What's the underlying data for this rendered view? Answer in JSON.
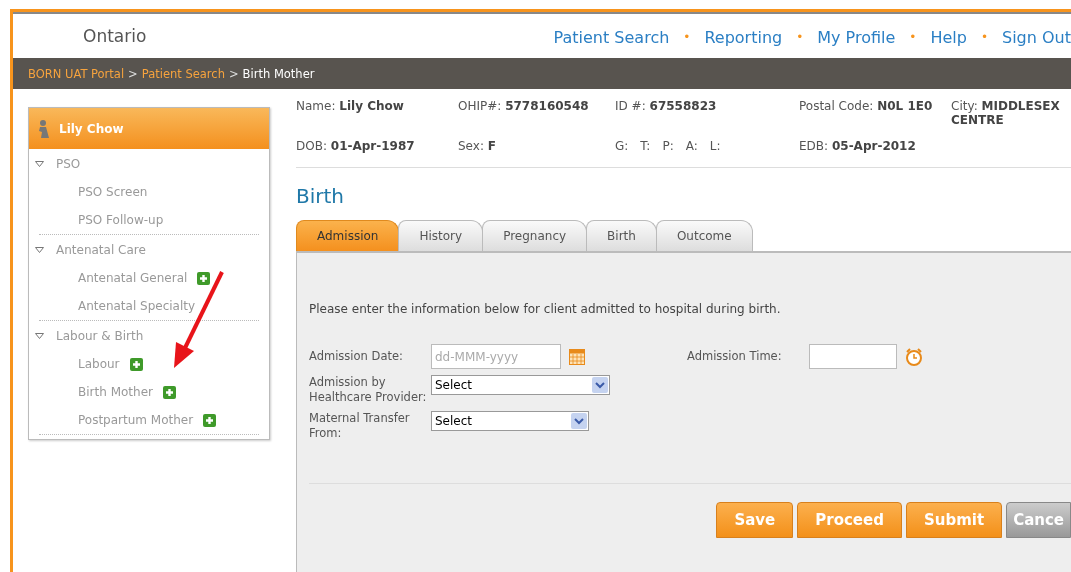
{
  "header": {
    "logo_text": "Ontario",
    "nav": [
      {
        "label": "Patient Search",
        "separator": "•"
      },
      {
        "label": "Reporting",
        "separator": "•"
      },
      {
        "label": "My Profile",
        "separator": "•"
      },
      {
        "label": "Help",
        "separator": "•"
      },
      {
        "label": "Sign Out"
      }
    ]
  },
  "breadcrumb": [
    {
      "label": "BORN UAT Portal",
      "link": true,
      "separator": ">"
    },
    {
      "label": "Patient Search",
      "link": true,
      "separator": ">"
    },
    {
      "label": "Birth Mother",
      "link": false
    }
  ],
  "sidebar": {
    "patient": "Lily Chow",
    "sections": [
      {
        "label": "PSO",
        "expanded": true,
        "children": [
          {
            "label": "PSO Screen",
            "add_button": false
          },
          {
            "label": "PSO Follow-up",
            "add_button": false
          }
        ]
      },
      {
        "label": "Antenatal Care",
        "expanded": true,
        "children": [
          {
            "label": "Antenatal General",
            "add_button": true
          },
          {
            "label": "Antenatal Specialty",
            "add_button": false
          }
        ]
      },
      {
        "label": "Labour & Birth",
        "expanded": true,
        "children": [
          {
            "label": "Labour",
            "add_button": true
          },
          {
            "label": "Birth Mother",
            "add_button": true
          },
          {
            "label": "Postpartum Mother",
            "add_button": true
          }
        ]
      }
    ]
  },
  "patient_info": [
    [
      {
        "kind": "field",
        "label": "Name:",
        "value": "Lily Chow"
      },
      {
        "kind": "field",
        "label": "OHIP#:",
        "value": "5778160548"
      },
      {
        "kind": "field",
        "label": "ID #:",
        "value": "67558823"
      },
      {
        "kind": "field",
        "label": "Postal Code:",
        "value": "N0L 1E0"
      },
      {
        "kind": "field",
        "label": "City:",
        "value": "MIDDLESEX CENTRE"
      }
    ],
    [
      {
        "kind": "field",
        "label": "DOB:",
        "value": "01-Apr-1987"
      },
      {
        "kind": "field",
        "label": "Sex:",
        "value": "F"
      },
      {
        "kind": "group",
        "labels": [
          "G:",
          "T:",
          "P:",
          "A:",
          "L:"
        ]
      },
      {
        "kind": "field",
        "label": "EDB:",
        "value": "05-Apr-2012"
      }
    ]
  ],
  "page_title": "Birth",
  "tabs": [
    {
      "label": "Admission",
      "selected": true
    },
    {
      "label": "History",
      "selected": false
    },
    {
      "label": "Pregnancy",
      "selected": false
    },
    {
      "label": "Birth",
      "selected": false
    },
    {
      "label": "Outcome",
      "selected": false
    }
  ],
  "form": {
    "intro": "Please enter the information below for client admitted to hospital during birth.",
    "admission_date": {
      "label": "Admission Date:",
      "placeholder": "dd-MMM-yyyy"
    },
    "admission_time": {
      "label": "Admission Time:"
    },
    "selects": [
      {
        "label": "Admission by Healthcare Provider:",
        "value": "Select"
      },
      {
        "label": "Maternal Transfer From:",
        "value": "Select"
      }
    ]
  },
  "buttons": [
    {
      "label": "Save",
      "disabled": false
    },
    {
      "label": "Proceed",
      "disabled": false
    },
    {
      "label": "Submit",
      "disabled": false
    },
    {
      "label": "Cance",
      "disabled": true
    }
  ]
}
